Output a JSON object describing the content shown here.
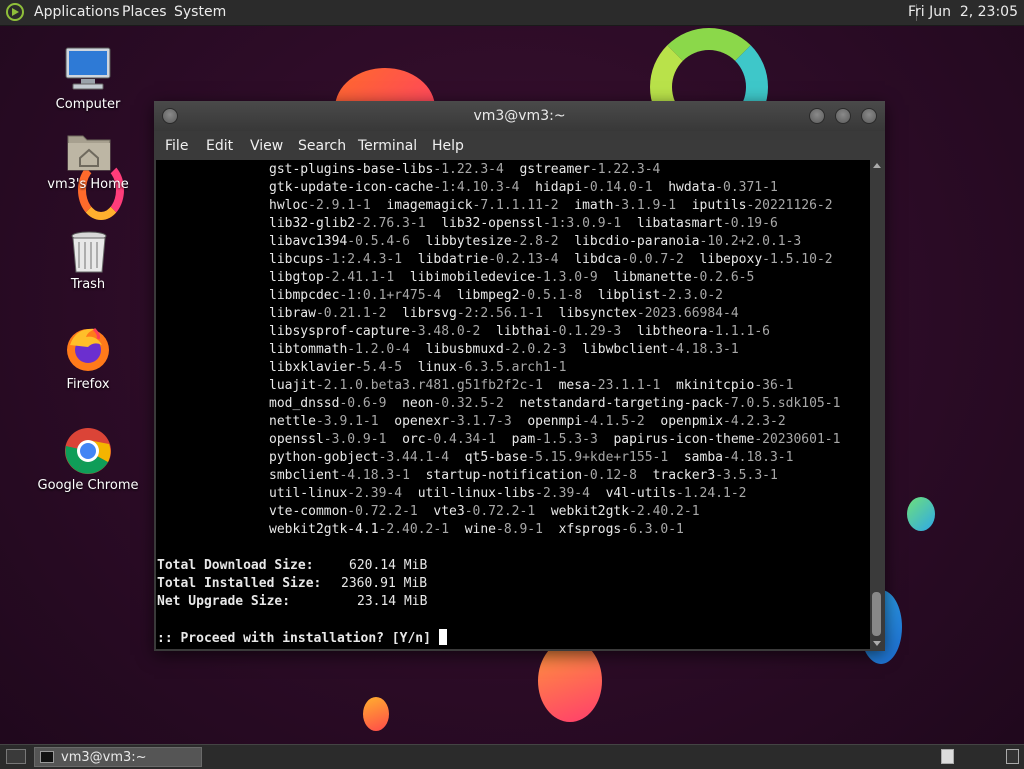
{
  "top_panel": {
    "menus": [
      "Applications",
      "Places",
      "System"
    ],
    "clock": "Fri Jun  2, 23:05"
  },
  "desktop_icons": [
    {
      "label": "Computer",
      "icon": "computer-icon"
    },
    {
      "label": "vm3's Home",
      "icon": "home-folder-icon"
    },
    {
      "label": "Trash",
      "icon": "trash-icon"
    },
    {
      "label": "Firefox",
      "icon": "firefox-icon"
    },
    {
      "label": "Google Chrome",
      "icon": "chrome-icon"
    }
  ],
  "window": {
    "title": "vm3@vm3:~",
    "menu": [
      "File",
      "Edit",
      "View",
      "Search",
      "Terminal",
      "Help"
    ]
  },
  "terminal": {
    "package_lines": [
      [
        [
          "gst-plugins-base-libs",
          "-1.22.3-4"
        ],
        [
          "gstreamer",
          "-1.22.3-4"
        ]
      ],
      [
        [
          "gtk-update-icon-cache",
          "-1:4.10.3-4"
        ],
        [
          "hidapi",
          "-0.14.0-1"
        ],
        [
          "hwdata",
          "-0.371-1"
        ]
      ],
      [
        [
          "hwloc",
          "-2.9.1-1"
        ],
        [
          "imagemagick",
          "-7.1.1.11-2"
        ],
        [
          "imath",
          "-3.1.9-1"
        ],
        [
          "iputils",
          "-20221126-2"
        ]
      ],
      [
        [
          "lib32-glib2",
          "-2.76.3-1"
        ],
        [
          "lib32-openssl",
          "-1:3.0.9-1"
        ],
        [
          "libatasmart",
          "-0.19-6"
        ]
      ],
      [
        [
          "libavc1394",
          "-0.5.4-6"
        ],
        [
          "libbytesize",
          "-2.8-2"
        ],
        [
          "libcdio-paranoia",
          "-10.2+2.0.1-3"
        ]
      ],
      [
        [
          "libcups",
          "-1:2.4.3-1"
        ],
        [
          "libdatrie",
          "-0.2.13-4"
        ],
        [
          "libdca",
          "-0.0.7-2"
        ],
        [
          "libepoxy",
          "-1.5.10-2"
        ]
      ],
      [
        [
          "libgtop",
          "-2.41.1-1"
        ],
        [
          "libimobiledevice",
          "-1.3.0-9"
        ],
        [
          "libmanette",
          "-0.2.6-5"
        ]
      ],
      [
        [
          "libmpcdec",
          "-1:0.1+r475-4"
        ],
        [
          "libmpeg2",
          "-0.5.1-8"
        ],
        [
          "libplist",
          "-2.3.0-2"
        ]
      ],
      [
        [
          "libraw",
          "-0.21.1-2"
        ],
        [
          "librsvg",
          "-2:2.56.1-1"
        ],
        [
          "libsynctex",
          "-2023.66984-4"
        ]
      ],
      [
        [
          "libsysprof-capture",
          "-3.48.0-2"
        ],
        [
          "libthai",
          "-0.1.29-3"
        ],
        [
          "libtheora",
          "-1.1.1-6"
        ]
      ],
      [
        [
          "libtommath",
          "-1.2.0-4"
        ],
        [
          "libusbmuxd",
          "-2.0.2-3"
        ],
        [
          "libwbclient",
          "-4.18.3-1"
        ]
      ],
      [
        [
          "libxklavier",
          "-5.4-5"
        ],
        [
          "linux",
          "-6.3.5.arch1-1"
        ]
      ],
      [
        [
          "luajit",
          "-2.1.0.beta3.r481.g51fb2f2c-1"
        ],
        [
          "mesa",
          "-23.1.1-1"
        ],
        [
          "mkinitcpio",
          "-36-1"
        ]
      ],
      [
        [
          "mod_dnssd",
          "-0.6-9"
        ],
        [
          "neon",
          "-0.32.5-2"
        ],
        [
          "netstandard-targeting-pack",
          "-7.0.5.sdk105-1"
        ]
      ],
      [
        [
          "nettle",
          "-3.9.1-1"
        ],
        [
          "openexr",
          "-3.1.7-3"
        ],
        [
          "openmpi",
          "-4.1.5-2"
        ],
        [
          "openpmix",
          "-4.2.3-2"
        ]
      ],
      [
        [
          "openssl",
          "-3.0.9-1"
        ],
        [
          "orc",
          "-0.4.34-1"
        ],
        [
          "pam",
          "-1.5.3-3"
        ],
        [
          "papirus-icon-theme",
          "-20230601-1"
        ]
      ],
      [
        [
          "python-gobject",
          "-3.44.1-4"
        ],
        [
          "qt5-base",
          "-5.15.9+kde+r155-1"
        ],
        [
          "samba",
          "-4.18.3-1"
        ]
      ],
      [
        [
          "smbclient",
          "-4.18.3-1"
        ],
        [
          "startup-notification",
          "-0.12-8"
        ],
        [
          "tracker3",
          "-3.5.3-1"
        ]
      ],
      [
        [
          "util-linux",
          "-2.39-4"
        ],
        [
          "util-linux-libs",
          "-2.39-4"
        ],
        [
          "v4l-utils",
          "-1.24.1-2"
        ]
      ],
      [
        [
          "vte-common",
          "-0.72.2-1"
        ],
        [
          "vte3",
          "-0.72.2-1"
        ],
        [
          "webkit2gtk",
          "-2.40.2-1"
        ]
      ],
      [
        [
          "webkit2gtk-4.1",
          "-2.40.2-1"
        ],
        [
          "wine",
          "-8.9-1"
        ],
        [
          "xfsprogs",
          "-6.3.0-1"
        ]
      ]
    ],
    "summary": [
      {
        "label": "Total Download Size:",
        "value": "620.14 MiB"
      },
      {
        "label": "Total Installed Size:",
        "value": "2360.91 MiB"
      },
      {
        "label": "Net Upgrade Size:",
        "value": "23.14 MiB"
      }
    ],
    "prompt": ":: Proceed with installation? [Y/n] "
  },
  "bottom_panel": {
    "task_label": "vm3@vm3:~"
  }
}
